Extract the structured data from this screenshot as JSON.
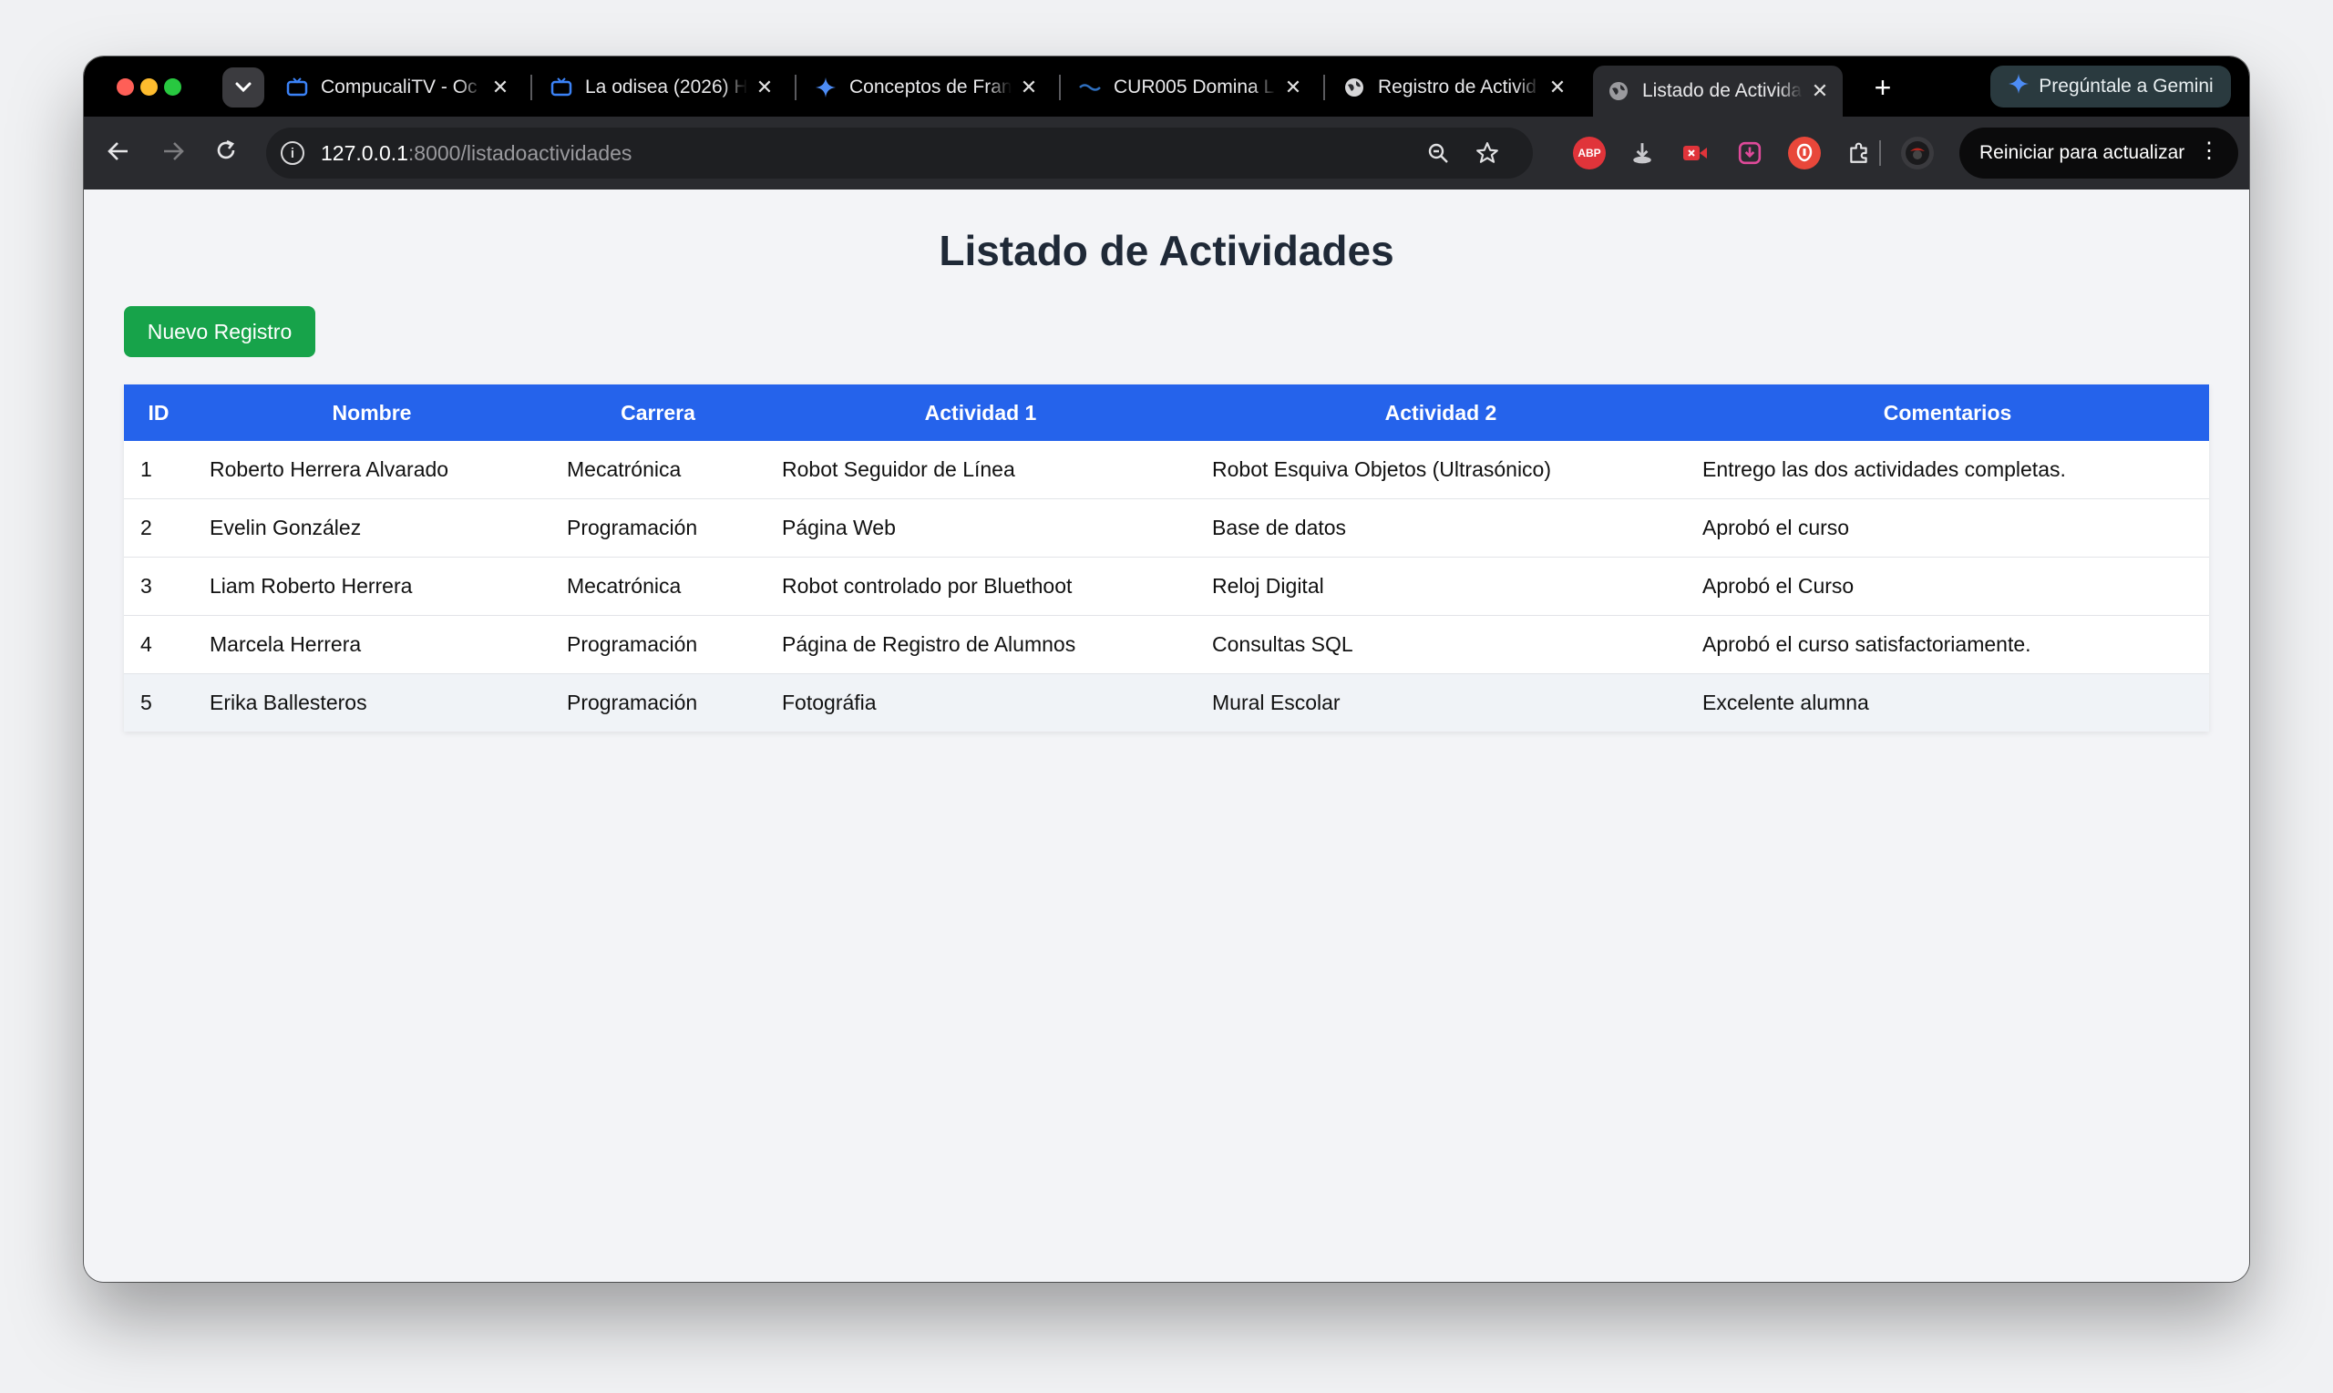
{
  "browser": {
    "tabs": [
      {
        "title": "CompucaliTV - Oc",
        "favicon": "tv-icon"
      },
      {
        "title": "La odisea (2026) H",
        "favicon": "tv-icon"
      },
      {
        "title": "Conceptos de Fran",
        "favicon": "gemini-icon"
      },
      {
        "title": "CUR005 Domina L",
        "favicon": "site-icon"
      },
      {
        "title": "Registro de Activid",
        "favicon": "globe-icon"
      },
      {
        "title": "Listado de Activida",
        "favicon": "globe-icon"
      }
    ],
    "gemini_label": "Pregúntale a Gemini",
    "url_host": "127.0.0.1",
    "url_path": ":8000/listadoactividades",
    "update_label": "Reiniciar para actualizar",
    "extensions": [
      "adblock-icon",
      "download-icon",
      "video-icon",
      "save-icon",
      "shield-icon",
      "puzzle-icon"
    ]
  },
  "page": {
    "title": "Listado de Actividades",
    "new_button": "Nuevo Registro",
    "columns": {
      "id": "ID",
      "nombre": "Nombre",
      "carrera": "Carrera",
      "actividad1": "Actividad 1",
      "actividad2": "Actividad 2",
      "comentarios": "Comentarios"
    },
    "rows": [
      {
        "id": "1",
        "nombre": "Roberto Herrera Alvarado",
        "carrera": "Mecatrónica",
        "actividad1": "Robot Seguidor de Línea",
        "actividad2": "Robot Esquiva Objetos (Ultrasónico)",
        "comentarios": "Entrego las dos actividades completas."
      },
      {
        "id": "2",
        "nombre": "Evelin González",
        "carrera": "Programación",
        "actividad1": "Página Web",
        "actividad2": "Base de datos",
        "comentarios": "Aprobó el curso"
      },
      {
        "id": "3",
        "nombre": "Liam Roberto Herrera",
        "carrera": "Mecatrónica",
        "actividad1": "Robot controlado por Bluethoot",
        "actividad2": "Reloj Digital",
        "comentarios": "Aprobó el Curso"
      },
      {
        "id": "4",
        "nombre": "Marcela Herrera",
        "carrera": "Programación",
        "actividad1": "Página de Registro de Alumnos",
        "actividad2": "Consultas SQL",
        "comentarios": "Aprobó el curso satisfactoriamente."
      },
      {
        "id": "5",
        "nombre": "Erika Ballesteros",
        "carrera": "Programación",
        "actividad1": "Fotográfia",
        "actividad2": "Mural Escolar",
        "comentarios": "Excelente alumna"
      }
    ]
  },
  "colors": {
    "header_blue": "#2563eb",
    "button_green": "#17a34a",
    "page_bg": "#f3f4f7"
  }
}
